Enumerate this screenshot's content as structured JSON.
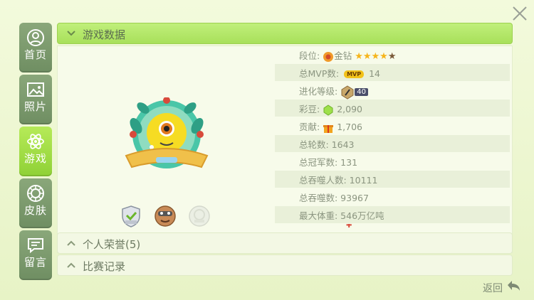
{
  "window": {
    "close_icon": "close-x-icon"
  },
  "sidebar": {
    "items": [
      {
        "label": "首页",
        "icon": "person-circle-icon",
        "active": false
      },
      {
        "label": "照片",
        "icon": "photo-icon",
        "active": false
      },
      {
        "label": "游戏",
        "icon": "atom-icon",
        "active": true
      },
      {
        "label": "皮肤",
        "icon": "skin-circle-icon",
        "active": false
      },
      {
        "label": "留言",
        "icon": "message-icon",
        "active": false
      }
    ]
  },
  "sections": {
    "game_data": "游戏数据",
    "honors": "个人荣誉(5)",
    "match_records": "比赛记录"
  },
  "stats": {
    "rank_label": "段位:",
    "rank_value": "金钻",
    "rank_stars": 4,
    "rank_stars_total": 5,
    "mvp_label": "总MVP数:",
    "mvp_badge": "MVP",
    "mvp_value": "14",
    "evolve_label": "进化等级:",
    "evolve_value": "40",
    "beans_label": "彩豆:",
    "beans_value": "2,090",
    "contrib_label": "贡献:",
    "contrib_value": "1,706",
    "rounds": "总轮数: 1643",
    "champions": "总冠军数: 131",
    "eaten_players": "总吞噬人数: 10111",
    "eaten_total": "总吞噬数: 93967",
    "max_weight": "最大体重: 546万亿吨"
  },
  "footer": {
    "back_label": "返回"
  },
  "colors": {
    "accent": "#a8e05a",
    "nav": "#7b9a6d",
    "star": "#f6b51c"
  }
}
